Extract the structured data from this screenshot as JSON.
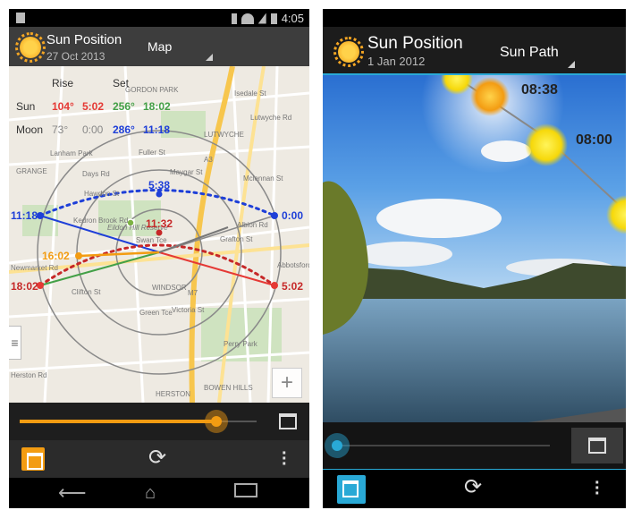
{
  "left_screen": {
    "status": {
      "time": "4:05"
    },
    "app_title": "Sun Position",
    "date": "27 Oct 2013",
    "view_mode": "Map",
    "table": {
      "header_rise": "Rise",
      "header_set": "Set",
      "sun_label": "Sun",
      "sun_rise_azimuth": "104°",
      "sun_rise_time": "5:02",
      "sun_set_azimuth": "256°",
      "sun_set_time": "18:02",
      "moon_label": "Moon",
      "moon_rise_azimuth": "73°",
      "moon_rise_time": "0:00",
      "moon_set_azimuth": "286°",
      "moon_set_time": "11:18"
    },
    "map_time_labels": {
      "moon_set": "11:18",
      "moon_high": "5:38",
      "moon_rise": "0:00",
      "sun_noon": "11:32",
      "current": "16:02",
      "sun_set": "18:02",
      "sun_rise": "5:02"
    },
    "map_places": [
      "GORDON PARK",
      "Isedale St",
      "LUTWYCHE",
      "Lanham Park",
      "GRANGE",
      "Days Rd",
      "Fuller St",
      "Maygar St",
      "Hawdon St",
      "Eildon Hill Reserve",
      "Newmarket Rd",
      "Clifton St",
      "WINDSOR",
      "Perry Park",
      "Herston Rd",
      "HERSTON",
      "BOWEN HILLS",
      "A3",
      "M7",
      "Lutwyche Rd",
      "Victoria St",
      "Albion Rd",
      "Abbotsford Rd",
      "Green Tce",
      "Grafton St",
      "Kedron Brook Rd",
      "Mclennan St",
      "Swan Tce"
    ],
    "zoom_plus": "+",
    "drawer_icon": "≡",
    "colors": {
      "sun_rise": "#e53935",
      "sun_set": "#43a047",
      "moon": "#1e3fd8",
      "current": "#f39c12",
      "accent": "#f39c12"
    }
  },
  "right_screen": {
    "app_title": "Sun Position",
    "date": "1 Jan 2012",
    "view_mode": "Sun Path",
    "time_labels": [
      "08:38",
      "08:00"
    ],
    "colors": {
      "accent": "#29a9d6"
    }
  }
}
